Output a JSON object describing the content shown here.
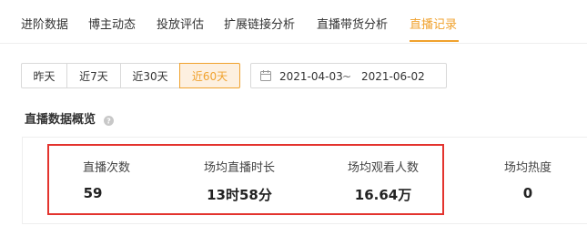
{
  "tabs": [
    {
      "label": "进阶数据"
    },
    {
      "label": "博主动态"
    },
    {
      "label": "投放评估"
    },
    {
      "label": "扩展链接分析"
    },
    {
      "label": "直播带货分析"
    },
    {
      "label": "直播记录",
      "active": true
    }
  ],
  "date_filter": {
    "presets": [
      "昨天",
      "近7天",
      "近30天",
      "近60天"
    ],
    "selected": "近60天",
    "start": "2021-04-03",
    "separator": "~",
    "end": "2021-06-02"
  },
  "overview": {
    "title": "直播数据概览",
    "metrics": [
      {
        "label": "直播次数",
        "value": "59"
      },
      {
        "label": "场均直播时长",
        "value": "13时58分"
      },
      {
        "label": "场均观看人数",
        "value": "16.64万"
      },
      {
        "label": "场均热度",
        "value": "0"
      }
    ]
  },
  "colors": {
    "accent": "#f0a22e",
    "highlight_border": "#e3332e",
    "active_bg": "#fdf0e0"
  },
  "icons": {
    "calendar": "calendar-icon",
    "help": "question-circle-icon"
  }
}
